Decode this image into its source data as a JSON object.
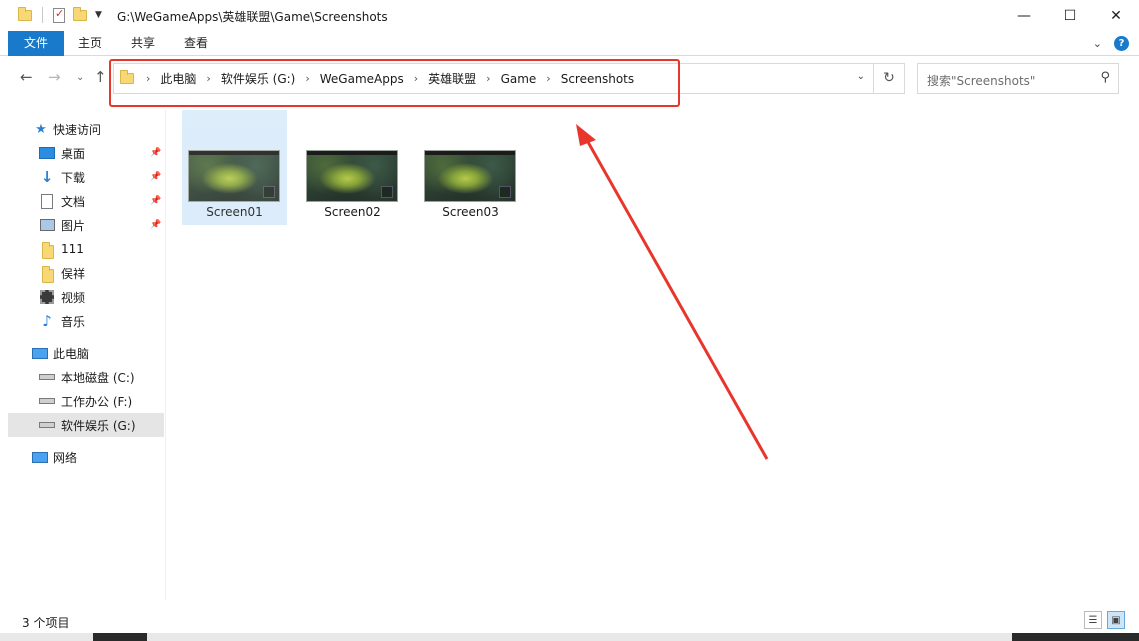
{
  "window": {
    "title": "G:\\WeGameApps\\英雄联盟\\Game\\Screenshots",
    "minimize": "—",
    "maximize": "☐",
    "close": "✕"
  },
  "ribbon": {
    "tabs": [
      "文件",
      "主页",
      "共享",
      "查看"
    ],
    "help": "?"
  },
  "nav": {
    "breadcrumbs": [
      "此电脑",
      "软件娱乐 (G:)",
      "WeGameApps",
      "英雄联盟",
      "Game",
      "Screenshots"
    ],
    "search_placeholder": "搜索\"Screenshots\""
  },
  "sidebar": {
    "items": [
      {
        "label": "快速访问",
        "icon": "star-icon"
      },
      {
        "label": "桌面",
        "icon": "desktop-icon",
        "pinned": true
      },
      {
        "label": "下载",
        "icon": "download-icon",
        "pinned": true
      },
      {
        "label": "文档",
        "icon": "document-icon",
        "pinned": true
      },
      {
        "label": "图片",
        "icon": "pictures-icon",
        "pinned": true
      },
      {
        "label": "111",
        "icon": "folder-icon"
      },
      {
        "label": "俣祥",
        "icon": "folder-icon"
      },
      {
        "label": "视频",
        "icon": "video-icon"
      },
      {
        "label": "音乐",
        "icon": "music-icon"
      },
      {
        "label": "此电脑",
        "icon": "pc-icon"
      },
      {
        "label": "本地磁盘 (C:)",
        "icon": "drive-icon"
      },
      {
        "label": "工作办公 (F:)",
        "icon": "drive-icon"
      },
      {
        "label": "软件娱乐 (G:)",
        "icon": "drive-icon",
        "selected": true
      },
      {
        "label": "网络",
        "icon": "network-icon"
      }
    ]
  },
  "files": [
    {
      "name": "Screen01",
      "selected": true
    },
    {
      "name": "Screen02"
    },
    {
      "name": "Screen03"
    }
  ],
  "status": {
    "count": "3 个项目"
  },
  "colors": {
    "accent": "#1979ca",
    "annotation": "#e8362c",
    "selection": "#d9ebfa"
  }
}
